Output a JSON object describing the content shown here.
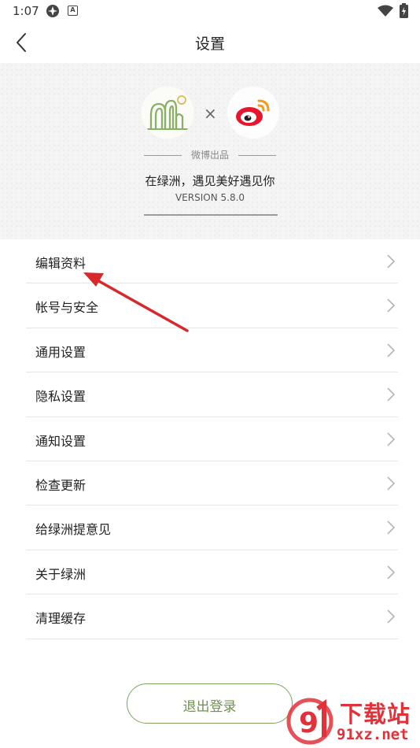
{
  "status_bar": {
    "time": "1:07",
    "notif_label": "A"
  },
  "header": {
    "title": "设置"
  },
  "hero": {
    "times": "×",
    "produced_by": "微博出品",
    "slogan": "在绿洲，遇见美好遇见你",
    "version": "VERSION 5.8.0"
  },
  "menu": {
    "items": [
      {
        "label": "编辑资料"
      },
      {
        "label": "帐号与安全"
      },
      {
        "label": "通用设置"
      },
      {
        "label": "隐私设置"
      },
      {
        "label": "通知设置"
      },
      {
        "label": "检查更新"
      },
      {
        "label": "给绿洲提意见"
      },
      {
        "label": "关于绿洲"
      },
      {
        "label": "清理缓存"
      }
    ]
  },
  "logout": {
    "label": "退出登录"
  },
  "watermark": {
    "title": "下载站",
    "url": "91xz.net"
  },
  "colors": {
    "accent_green": "#6f9150",
    "annotation_red": "#d8282b",
    "watermark_red": "#e0323a"
  }
}
